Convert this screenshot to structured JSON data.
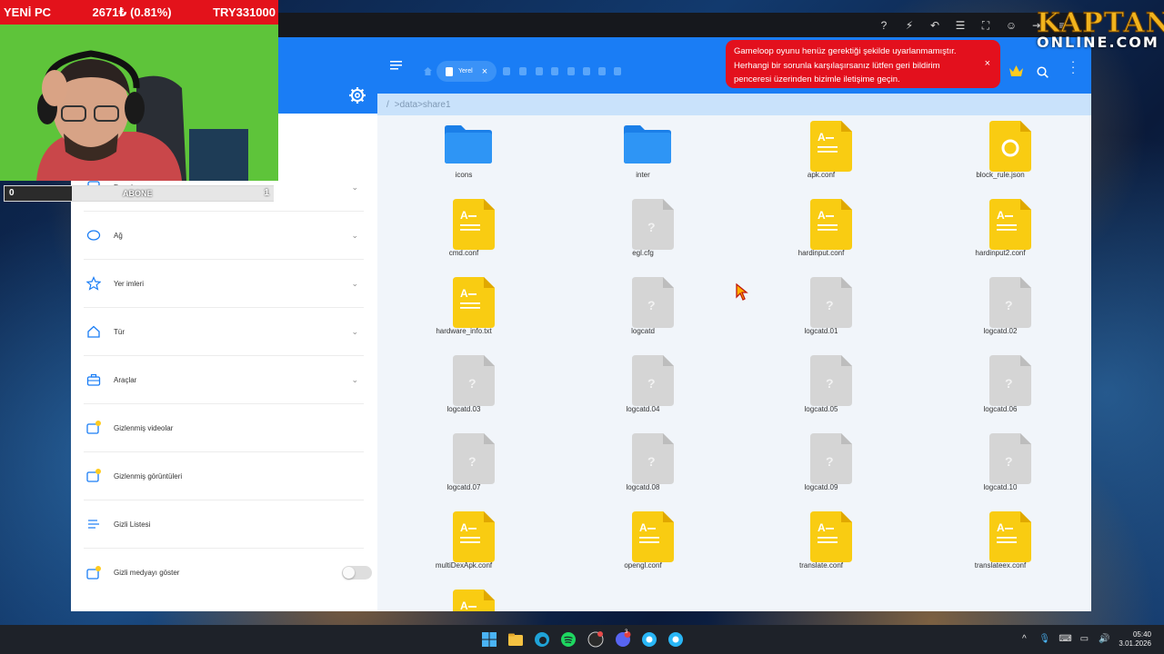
{
  "overlay": {
    "stock_title": "YENİ PC",
    "stock_value": "2671₺ (0.81%)",
    "stock_total": "TRY331000",
    "sub_left": "0",
    "sub_label": "ABONE",
    "sub_right": "1",
    "logo_line1": "KAPTAN",
    "logo_line2": "ONLINE.COM"
  },
  "notification": {
    "line1": "Gameloop oyunu henüz gerektiği şekilde uyarlanmamıştır.",
    "line2": "Herhangi bir sorunla karşılaşırsanız lütfen geri bildirim",
    "line3": "penceresi üzerinden bizimle iletişime geçin.",
    "close": "×"
  },
  "header": {
    "tab_label": "Yerel",
    "tab_close": "×"
  },
  "breadcrumb": {
    "root": "/",
    "path": ">data>share1"
  },
  "sidebar": {
    "items": [
      {
        "label": "Depolama",
        "icon": "storage-icon",
        "expandable": true
      },
      {
        "label": "Ağ",
        "icon": "network-icon",
        "expandable": true
      },
      {
        "label": "Yer imleri",
        "icon": "star-icon",
        "expandable": true
      },
      {
        "label": "Tür",
        "icon": "home-icon",
        "expandable": true
      },
      {
        "label": "Araçlar",
        "icon": "toolbox-icon",
        "expandable": true
      },
      {
        "label": "Gizlenmiş videolar",
        "icon": "hidden-video-icon",
        "expandable": false
      },
      {
        "label": "Gizlenmiş görüntüleri",
        "icon": "hidden-image-icon",
        "expandable": false
      },
      {
        "label": "Gizli Listesi",
        "icon": "list-icon",
        "expandable": false
      },
      {
        "label": "Gizli medyayı göster",
        "icon": "hidden-media-icon",
        "toggle": "off"
      }
    ]
  },
  "files": [
    {
      "name": "icons",
      "type": "folder"
    },
    {
      "name": "inter",
      "type": "folder"
    },
    {
      "name": "apk.conf",
      "type": "doc"
    },
    {
      "name": "block_rule.json",
      "type": "json"
    },
    {
      "name": "cmd.conf",
      "type": "doc"
    },
    {
      "name": "egl.cfg",
      "type": "unknown"
    },
    {
      "name": "hardinput.conf",
      "type": "doc"
    },
    {
      "name": "hardinput2.conf",
      "type": "doc"
    },
    {
      "name": "hardware_info.txt",
      "type": "doc"
    },
    {
      "name": "logcatd",
      "type": "unknown"
    },
    {
      "name": "logcatd.01",
      "type": "unknown"
    },
    {
      "name": "logcatd.02",
      "type": "unknown"
    },
    {
      "name": "logcatd.03",
      "type": "unknown"
    },
    {
      "name": "logcatd.04",
      "type": "unknown"
    },
    {
      "name": "logcatd.05",
      "type": "unknown"
    },
    {
      "name": "logcatd.06",
      "type": "unknown"
    },
    {
      "name": "logcatd.07",
      "type": "unknown"
    },
    {
      "name": "logcatd.08",
      "type": "unknown"
    },
    {
      "name": "logcatd.09",
      "type": "unknown"
    },
    {
      "name": "logcatd.10",
      "type": "unknown"
    },
    {
      "name": "multiDexApk.conf",
      "type": "doc"
    },
    {
      "name": "opengl.conf",
      "type": "doc"
    },
    {
      "name": "translate.conf",
      "type": "doc"
    },
    {
      "name": "translateex.conf",
      "type": "doc"
    },
    {
      "name": "",
      "type": "doc"
    }
  ],
  "taskbar": {
    "time": "05:40",
    "date": "3.01.2026",
    "discord_badge": "3"
  },
  "colors": {
    "header_blue": "#1a7df5",
    "notification_red": "#e3101d",
    "doc_yellow": "#f9cc12",
    "folder_blue": "#2e95f5"
  }
}
